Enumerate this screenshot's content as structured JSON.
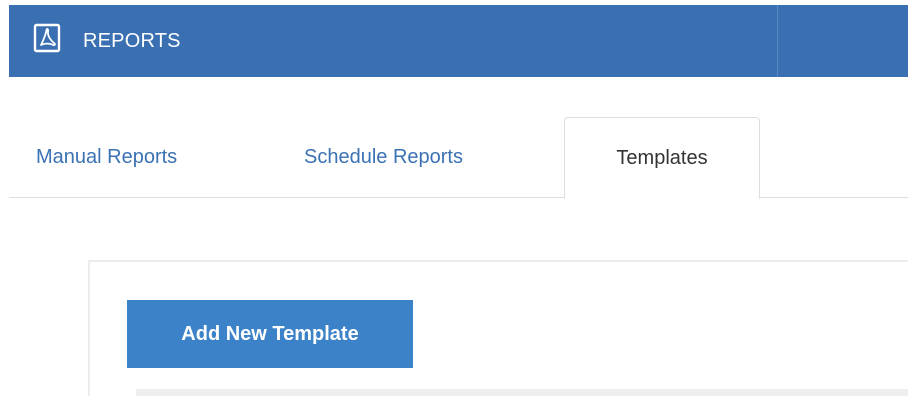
{
  "header": {
    "title": "REPORTS",
    "icon": "pdf-file-icon",
    "background_color": "#3a70b2"
  },
  "tabs": [
    {
      "label": "Manual Reports",
      "active": false
    },
    {
      "label": "Schedule Reports",
      "active": false
    },
    {
      "label": "Templates",
      "active": true
    }
  ],
  "templates_panel": {
    "add_button_label": "Add New Template",
    "button_color": "#3c82c8"
  },
  "colors": {
    "link": "#3b72b4",
    "active_tab_text": "#333333"
  }
}
